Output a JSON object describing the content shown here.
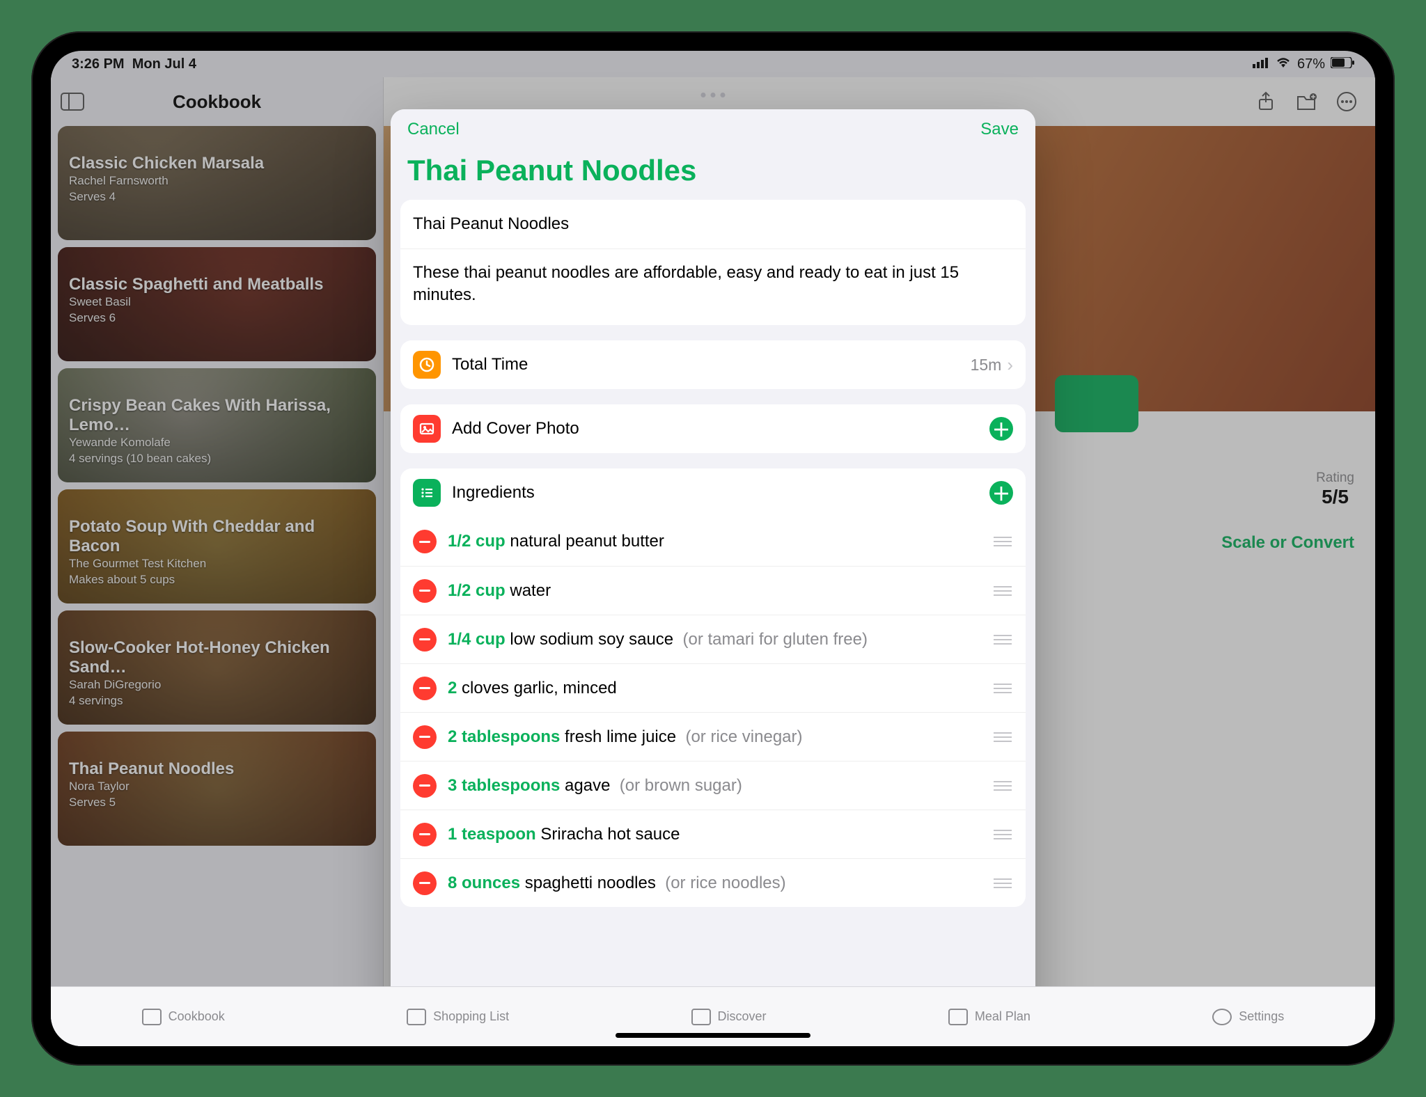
{
  "status": {
    "time": "3:26 PM",
    "date": "Mon Jul 4",
    "battery": "67%"
  },
  "sidebar": {
    "title": "Cookbook",
    "recipes": [
      {
        "title": "Classic Chicken Marsala",
        "author": "Rachel Farnsworth",
        "serves": "Serves 4"
      },
      {
        "title": "Classic Spaghetti and Meatballs",
        "author": "Sweet Basil",
        "serves": "Serves 6"
      },
      {
        "title": "Crispy Bean Cakes With Harissa, Lemo…",
        "author": "Yewande Komolafe",
        "serves": "4 servings (10 bean cakes)"
      },
      {
        "title": "Potato Soup With Cheddar and Bacon",
        "author": "The Gourmet Test Kitchen",
        "serves": "Makes about 5 cups"
      },
      {
        "title": "Slow-Cooker Hot-Honey Chicken Sand…",
        "author": "Sarah DiGregorio",
        "serves": "4 servings"
      },
      {
        "title": "Thai Peanut Noodles",
        "author": "Nora Taylor",
        "serves": "Serves 5"
      }
    ]
  },
  "detail": {
    "rating_label": "Rating",
    "rating_value": "5/5",
    "scale_link": "Scale or Convert"
  },
  "tabs": {
    "cookbook": "Cookbook",
    "shopping": "Shopping List",
    "discover": "Discover",
    "meal": "Meal Plan",
    "settings": "Settings"
  },
  "modal": {
    "cancel": "Cancel",
    "save": "Save",
    "title": "Thai Peanut Noodles",
    "name_value": "Thai Peanut Noodles",
    "description": "These thai peanut noodles are affordable, easy and ready to eat in just 15 minutes.",
    "total_time_label": "Total Time",
    "total_time_value": "15m",
    "add_cover": "Add Cover Photo",
    "ingredients_label": "Ingredients",
    "ingredients": [
      {
        "qty": "1/2 cup",
        "name": "natural peanut butter",
        "note": ""
      },
      {
        "qty": "1/2 cup",
        "name": "water",
        "note": ""
      },
      {
        "qty": "1/4 cup",
        "name": "low sodium soy sauce",
        "note": "(or tamari for gluten free)"
      },
      {
        "qty": "2",
        "name": "cloves garlic, minced",
        "note": ""
      },
      {
        "qty": "2 tablespoons",
        "name": "fresh lime juice",
        "note": "(or rice vinegar)"
      },
      {
        "qty": "3 tablespoons",
        "name": "agave",
        "note": "(or brown sugar)"
      },
      {
        "qty": "1 teaspoon",
        "name": "Sriracha hot sauce",
        "note": ""
      },
      {
        "qty": "8 ounces",
        "name": "spaghetti noodles",
        "note": "(or rice noodles)"
      }
    ]
  }
}
